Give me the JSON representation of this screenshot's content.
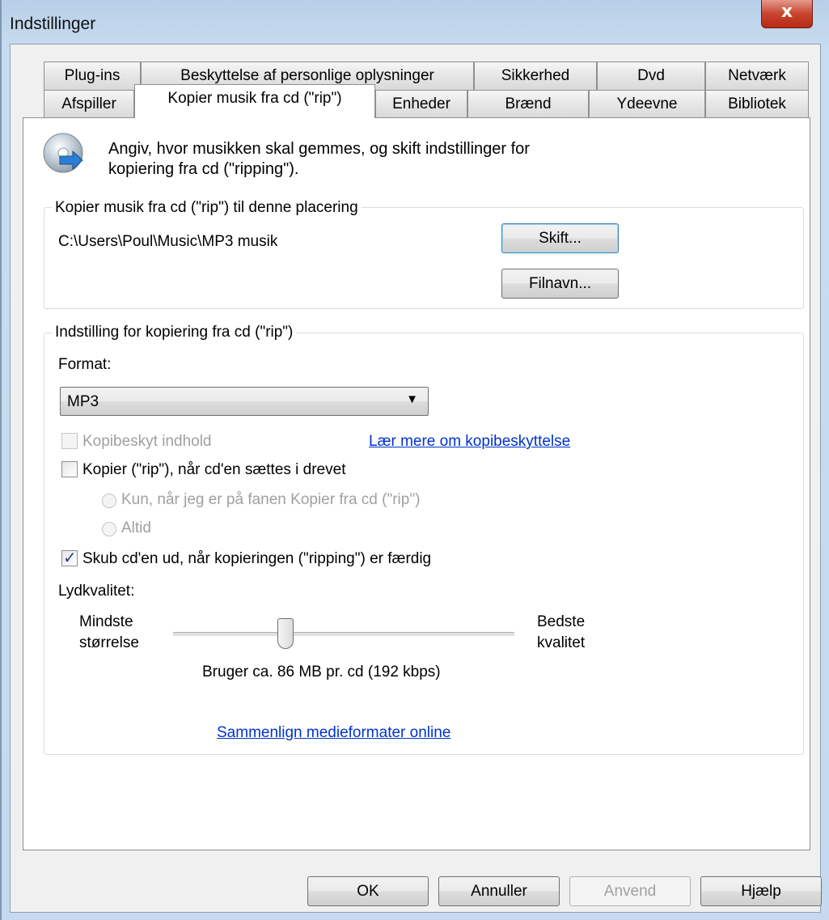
{
  "window": {
    "title": "Indstillinger",
    "close_glyph": "x"
  },
  "tabs_row1": [
    {
      "label": "Plug-ins"
    },
    {
      "label": "Beskyttelse af personlige oplysninger"
    },
    {
      "label": "Sikkerhed"
    },
    {
      "label": "Dvd"
    },
    {
      "label": "Netværk"
    }
  ],
  "tabs_row2": [
    {
      "label": "Afspiller"
    },
    {
      "label": "Kopier musik fra cd (\"rip\")",
      "active": true
    },
    {
      "label": "Enheder"
    },
    {
      "label": "Brænd"
    },
    {
      "label": "Ydeevne"
    },
    {
      "label": "Bibliotek"
    }
  ],
  "intro": {
    "icon": "cd-rip-icon",
    "line1": "Angiv, hvor musikken skal gemmes, og skift indstillinger for",
    "line2": "kopiering fra cd (\"ripping\")."
  },
  "location_group": {
    "legend": "Kopier musik fra cd (\"rip\") til denne placering",
    "path": "C:\\Users\\Poul\\Music\\MP3 musik",
    "change_button": "Skift...",
    "filename_button": "Filnavn..."
  },
  "settings_group": {
    "legend": "Indstilling for kopiering fra cd (\"rip\")",
    "format_label": "Format:",
    "format_value": "MP3",
    "copy_protect": {
      "label": "Kopibeskyt indhold",
      "checked": false,
      "enabled": false
    },
    "copy_protect_link": "Lær mere om kopibeskyttelse",
    "auto_rip": {
      "label": "Kopier (\"rip\"), når cd'en sættes i drevet",
      "checked": false
    },
    "radio_only_tab": {
      "label": "Kun, når jeg er på fanen Kopier fra cd (\"rip\")",
      "enabled": false
    },
    "radio_always": {
      "label": "Altid",
      "enabled": false
    },
    "eject": {
      "label": "Skub cd'en ud, når kopieringen (\"ripping\") er færdig",
      "checked": true
    },
    "quality_label": "Lydkvalitet:",
    "min_line1": "Mindste",
    "min_line2": "størrelse",
    "max_line1": "Bedste",
    "max_line2": "kvalitet",
    "usage_text": "Bruger ca. 86 MB pr. cd (192 kbps)",
    "slider_level": 0.33,
    "compare_link": "Sammenlign medieformater online"
  },
  "buttons": {
    "ok": "OK",
    "cancel": "Annuller",
    "apply": "Anvend",
    "help": "Hjælp"
  }
}
